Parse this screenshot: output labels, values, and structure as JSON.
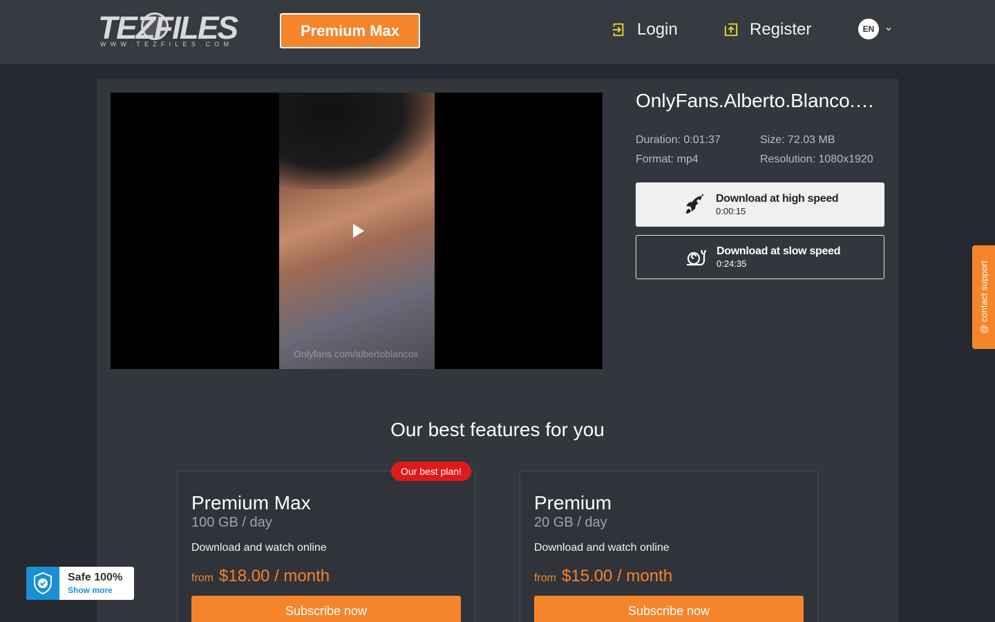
{
  "header": {
    "logo_text": "TEZFILES",
    "logo_sub": "WWW.TEZFILES.COM",
    "premium_label": "Premium Max",
    "login_label": "Login",
    "register_label": "Register",
    "language": "EN"
  },
  "file": {
    "title": "OnlyFans.Alberto.Blanco.…",
    "duration": "Duration: 0:01:37",
    "size": "Size: 72.03 MB",
    "format": "Format: mp4",
    "resolution": "Resolution: 1080x1920",
    "watermark": "Onlyfans.com/albertoblancox"
  },
  "download": {
    "fast_label": "Download at high speed",
    "fast_time": "0:00:15",
    "slow_label": "Download at slow speed",
    "slow_time": "0:24:35"
  },
  "features": {
    "title": "Our best features for you",
    "plans": [
      {
        "badge": "Our best plan!",
        "name": "Premium Max",
        "quota": "100 GB / day",
        "desc": "Download and watch online",
        "from": "from",
        "price": "$18.00 / month",
        "cta": "Subscribe now"
      },
      {
        "name": "Premium",
        "quota": "20 GB / day",
        "desc": "Download and watch online",
        "from": "from",
        "price": "$15.00 / month",
        "cta": "Subscribe now"
      }
    ]
  },
  "support": {
    "label": "@ contact support"
  },
  "safe_badge": {
    "title": "Safe 100%",
    "link": "Show more"
  },
  "colors": {
    "accent": "#f5852b",
    "header_bg": "#363a41",
    "page_bg": "#26292f",
    "panel_bg": "#33363d",
    "badge_red": "#e01a1a",
    "safe_blue": "#1a8fd6"
  },
  "icons": [
    "login-icon",
    "register-icon",
    "chevron-down-icon",
    "play-icon",
    "rocket-icon",
    "snail-icon",
    "shield-check-icon"
  ]
}
